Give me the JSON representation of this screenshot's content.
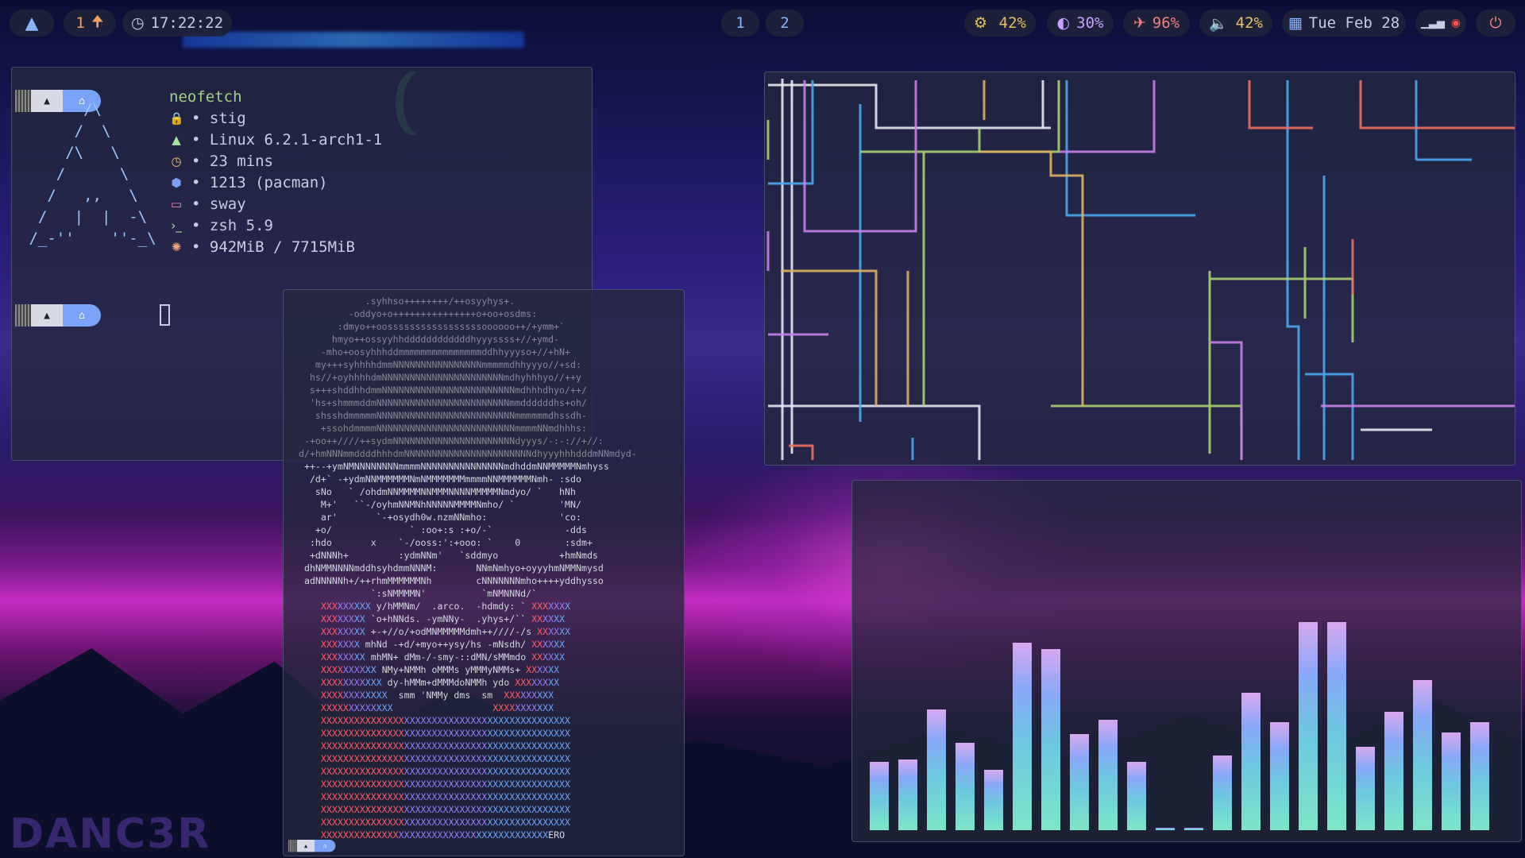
{
  "topbar": {
    "launcher_icon": "arch-icon",
    "updates": {
      "count": "1",
      "icon": "arrow-up-icon"
    },
    "clock": {
      "icon": "clock-icon",
      "time": "17:22:22"
    },
    "workspaces": [
      "1",
      "2"
    ],
    "cpu": {
      "icon": "cpu-icon",
      "value": "42%"
    },
    "brightness": {
      "icon": "brightness-icon",
      "value": "30%"
    },
    "battery": {
      "icon": "battery-icon",
      "value": "96%"
    },
    "volume": {
      "icon": "volume-icon",
      "value": "42%"
    },
    "date": {
      "icon": "calendar-icon",
      "value": "Tue Feb 28"
    },
    "tray": {
      "icons": [
        "wifi-icon",
        "app-tray-icon"
      ]
    },
    "power_icon": "power-icon"
  },
  "neofetch": {
    "command": "neofetch",
    "logo": "       /\\\n      /  \\\n     /\\   \\\n    /      \\\n   /   ,,   \\\n  /   |  |  -\\\n /_-''    ''-_\\",
    "info": [
      {
        "icon": "user-icon",
        "text": "• stig",
        "color": "#ff6b7a"
      },
      {
        "icon": "arch-icon",
        "text": "• Linux 6.2.1-arch1-1",
        "color": "#a6e3a1"
      },
      {
        "icon": "uptime-icon",
        "text": "• 23 mins",
        "color": "#f5c26b"
      },
      {
        "icon": "package-icon",
        "text": "• 1213 (pacman)",
        "color": "#7aa2f7"
      },
      {
        "icon": "window-icon",
        "text": "• sway",
        "color": "#f38ba8"
      },
      {
        "icon": "shell-icon",
        "text": "• zsh 5.9",
        "color": "#a6e3a1"
      },
      {
        "icon": "memory-icon",
        "text": "• 942MiB / 7715MiB",
        "color": "#f5a97f"
      }
    ]
  },
  "arco": {
    "lines": [
      "             .syhhso++++++++/++osyyhys+.",
      "          -oddyo+o+++++++++++++++o+oo+osdms:",
      "        :dmyo++oosssssssssssssssssoooooo++/+ymm+`",
      "       hmyo++ossyyhhddddddddddddhyyyssss+//+ymd-",
      "     -mho+oosyhhhddmmmmmmmmmmmmmmmddhhyyyso+//+hN+",
      "    my+++syhhhhdmmNNNNNNNNNNNNNNNNmmmmmdhhyyyo//+sd:",
      "   hs//+oyhhhhdmNNNNNNNNNNNNNNNNNNNNNNmdhyhhhyo//++y",
      "   s+++shddhhdmmNNNNNNNNNNNNNNNNNNNNNNNNmdhhhdhyo/++/",
      "   'hs+shmmmddmNNNNNNNNNNNNNNNNNNNNNNNNmmddddddhs+oh/",
      "    shsshdmmmmmNNNNNNNNNNNNNNNNNNNNNNNNNmmmmmmdhssdh-",
      "     +ssohdmmmmNNNNNNNNNNNNNNNNNNNNNNNNNmmmmNNmdhhhs:",
      "  -+oo++////++sydmNNNNNNNNNNNNNNNNNNNNNNdyyys/-:-://+//:",
      " d/+hmNNNmmddddhhhdmNNNNNNNNNNNNNNNNNNNNNNNdhyyyhhhdddmNNmdyd-",
      "  ++--+ymNMNNNNNNNNmmmmNNNNNNNNNNNNNNNmdhddmNNMMMMMNmhyss",
      "   /d+` -+ydmNNMMMMMMNmNMMMMMMMmmmmNNMMMMMMNmh- :sdo",
      "    sNo   ` /ohdmNNMMMMNNMMMNNNNMMMMMNmdyo/ `   hNh",
      "     M+'   ``-/oyhmNNMNhNNNNNMMMMNmho/ `        'MN/",
      "     ar'       `-+osydh0w.nzmNNmho:             'co:",
      "    +o/              ` :oo+:s :+o/-`             -dds",
      "   :hdo       x    `-/ooss:':+ooo: `    0        :sdm+",
      "   +dNNNh+         :ydmNNm'   `sddmyo           +hmNmds",
      "  dhNMMNNNNmddhsyhdmmNNNM:       NNmNmhyo+oyyyhmNMMNmysd",
      "  adNNNNNh+/++rhmMMMMMMNh        cNNNNNNNmho++++yddhysso",
      "              `:sNMMMMN'          `mNMNNNd/`",
      "     XXXXXXXXX y/hMMNm/  .arco.  -hdmdy: ` XXXXXXX",
      "     XXXXXXXX `o+hNNds. -ymNNy-  .yhys+/`` XXXXXX",
      "     XXXXXXXX +-+//o/+odMNMMMMMdmh++////-/s XXXXXX",
      "     XXXXXXX mhNd -+d/+myo++ysy/hs -mNsdh/ XXXXXX",
      "     XXXXXXXX mhMN+ dMm-/-smy-::dMN/sMMmdo XXXXXX",
      "     XXXXXXXXXX NMy+NMMh oMMMs yMMMyNMMs+ XXXXXX",
      "     XXXXXXXXXXX dy-hMMm+dMMMdoNMMh ydo XXXXXXXX",
      "     XXXXXXXXXXXX  smm 'NMMy dms  sm  XXXXXXXXX",
      "     XXXXXXXXXXXXX                  XXXXXXXXXXX",
      "     XXXXXXXXXXXXXXXXXXXXXXXXXXXXXXXXXXXXXXXXXXXXX",
      "     XXXXXXXXXXXXXXXXXXXXXXXXXXXXXXXXXXXXXXXXXXXXX",
      "     XXXXXXXXXXXXXXXXXXXXXXXXXXXXXXXXXXXXXXXXXXXXX",
      "     XXXXXXXXXXXXXXXXXXXXXXXXXXXXXXXXXXXXXXXXXXXXX",
      "     XXXXXXXXXXXXXXXXXXXXXXXXXXXXXXXXXXXXXXXXXXXXX",
      "     XXXXXXXXXXXXXXXXXXXXXXXXXXXXXXXXXXXXXXXXXXXXX",
      "     XXXXXXXXXXXXXXXXXXXXXXXXXXXXXXXXXXXXXXXXXXXXX",
      "     XXXXXXXXXXXXXXXXXXXXXXXXXXXXXXXXXXXXXXXXXXXXX",
      "     XXXXXXXXXXXXXXXXXXXXXXXXXXXXXXXXXXXXXXXXXXXXX",
      "     XXXXXXXXXXXXXXXXXXXXXXXXXXXXXXXXXXXXXXXXXERO"
    ]
  },
  "visualizer": {
    "levels": [
      0.33,
      0.34,
      0.58,
      0.42,
      0.29,
      0.9,
      0.87,
      0.46,
      0.53,
      0.33,
      0.01,
      0.01,
      0.36,
      0.66,
      0.52,
      1.0,
      1.0,
      0.4,
      0.57,
      0.72,
      0.47,
      0.52
    ]
  },
  "pipes": {
    "colors": [
      "#e8e8f0",
      "#4aa8f0",
      "#a8d070",
      "#e0b060",
      "#c880e8",
      "#f07060"
    ]
  },
  "watermark": {
    "text": "DANC3R"
  }
}
